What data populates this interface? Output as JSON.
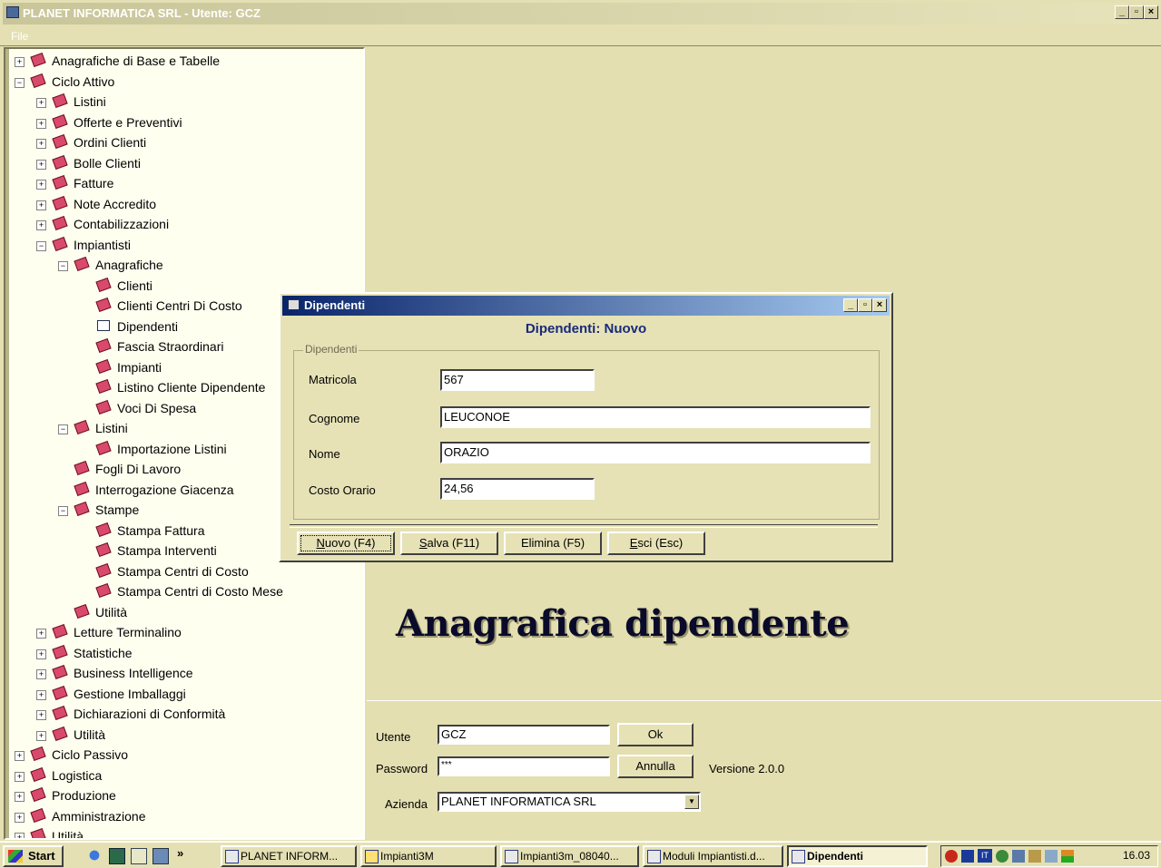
{
  "window": {
    "title": "PLANET INFORMATICA SRL    - Utente: GCZ",
    "menu_file": "File",
    "btn_min": "_",
    "btn_max": "▫",
    "btn_close": "×"
  },
  "tree": [
    {
      "label": "Anagrafiche di Base e Tabelle",
      "level": 0,
      "toggle": "+"
    },
    {
      "label": "Ciclo Attivo",
      "level": 0,
      "toggle": "−"
    },
    {
      "label": "Listini",
      "level": 1,
      "toggle": "+"
    },
    {
      "label": "Offerte e Preventivi",
      "level": 1,
      "toggle": "+"
    },
    {
      "label": "Ordini Clienti",
      "level": 1,
      "toggle": "+"
    },
    {
      "label": "Bolle Clienti",
      "level": 1,
      "toggle": "+"
    },
    {
      "label": "Fatture",
      "level": 1,
      "toggle": "+"
    },
    {
      "label": "Note Accredito",
      "level": 1,
      "toggle": "+"
    },
    {
      "label": "Contabilizzazioni",
      "level": 1,
      "toggle": "+"
    },
    {
      "label": "Impiantisti",
      "level": 1,
      "toggle": "−"
    },
    {
      "label": "Anagrafiche",
      "level": 2,
      "toggle": "−"
    },
    {
      "label": "Clienti",
      "level": 3,
      "toggle": ""
    },
    {
      "label": "Clienti Centri Di Costo",
      "level": 3,
      "toggle": ""
    },
    {
      "label": "Dipendenti",
      "level": 3,
      "toggle": "",
      "open": true
    },
    {
      "label": "Fascia Straordinari",
      "level": 3,
      "toggle": ""
    },
    {
      "label": "Impianti",
      "level": 3,
      "toggle": ""
    },
    {
      "label": "Listino Cliente Dipendente",
      "level": 3,
      "toggle": ""
    },
    {
      "label": "Voci Di Spesa",
      "level": 3,
      "toggle": ""
    },
    {
      "label": "Listini",
      "level": 2,
      "toggle": "−"
    },
    {
      "label": "Importazione Listini",
      "level": 3,
      "toggle": ""
    },
    {
      "label": "Fogli Di Lavoro",
      "level": 2,
      "toggle": ""
    },
    {
      "label": "Interrogazione Giacenza",
      "level": 2,
      "toggle": ""
    },
    {
      "label": "Stampe",
      "level": 2,
      "toggle": "−"
    },
    {
      "label": "Stampa Fattura",
      "level": 3,
      "toggle": ""
    },
    {
      "label": "Stampa Interventi",
      "level": 3,
      "toggle": ""
    },
    {
      "label": "Stampa Centri di Costo",
      "level": 3,
      "toggle": ""
    },
    {
      "label": "Stampa Centri di Costo Mese",
      "level": 3,
      "toggle": ""
    },
    {
      "label": "Utilità",
      "level": 2,
      "toggle": ""
    },
    {
      "label": "Letture Terminalino",
      "level": 1,
      "toggle": "+"
    },
    {
      "label": "Statistiche",
      "level": 1,
      "toggle": "+"
    },
    {
      "label": "Business Intelligence",
      "level": 1,
      "toggle": "+"
    },
    {
      "label": "Gestione Imballaggi",
      "level": 1,
      "toggle": "+"
    },
    {
      "label": "Dichiarazioni di Conformità",
      "level": 1,
      "toggle": "+"
    },
    {
      "label": "Utilità",
      "level": 1,
      "toggle": "+"
    },
    {
      "label": "Ciclo Passivo",
      "level": 0,
      "toggle": "+"
    },
    {
      "label": "Logistica",
      "level": 0,
      "toggle": "+"
    },
    {
      "label": "Produzione",
      "level": 0,
      "toggle": "+"
    },
    {
      "label": "Amministrazione",
      "level": 0,
      "toggle": "+"
    },
    {
      "label": "Utilità",
      "level": 0,
      "toggle": "+"
    }
  ],
  "dialog": {
    "title": "Dipendenti",
    "heading": "Dipendenti: Nuovo",
    "group_label": "Dipendenti",
    "matricola_label": "Matricola",
    "matricola_value": "567",
    "cognome_label": "Cognome",
    "cognome_value": "LEUCONOE",
    "nome_label": "Nome",
    "nome_value": "ORAZIO",
    "costo_label": "Costo Orario",
    "costo_value": "24,56",
    "btn_nuovo_a": "N",
    "btn_nuovo_b": "uovo (F4)",
    "btn_salva_a": "S",
    "btn_salva_b": "alva (F11)",
    "btn_elimina_a": "El",
    "btn_elimina_b": "imina (F5)",
    "btn_esci_a": "E",
    "btn_esci_b": "sci (Esc)"
  },
  "caption": "Anagrafica dipendente",
  "login": {
    "utente_label": "Utente",
    "utente_value": "GCZ",
    "password_label": "Password",
    "password_value": "***",
    "ok_label": "Ok",
    "annulla_label": "Annulla",
    "versione": "Versione 2.0.0",
    "azienda_label": "Azienda",
    "azienda_value": "PLANET INFORMATICA SRL"
  },
  "taskbar": {
    "start": "Start",
    "more": "»",
    "items": [
      {
        "label": "PLANET INFORM...",
        "icon": "app-window-icon"
      },
      {
        "label": "Impianti3M",
        "icon": "folder-search-icon"
      },
      {
        "label": "Impianti3m_08040...",
        "icon": "word-doc-icon"
      },
      {
        "label": "Moduli Impiantisti.d...",
        "icon": "word-doc-icon"
      },
      {
        "label": "Dipendenti",
        "icon": "app-window-icon",
        "active": true
      }
    ],
    "tray_lang": "IT",
    "clock": "16.03"
  }
}
